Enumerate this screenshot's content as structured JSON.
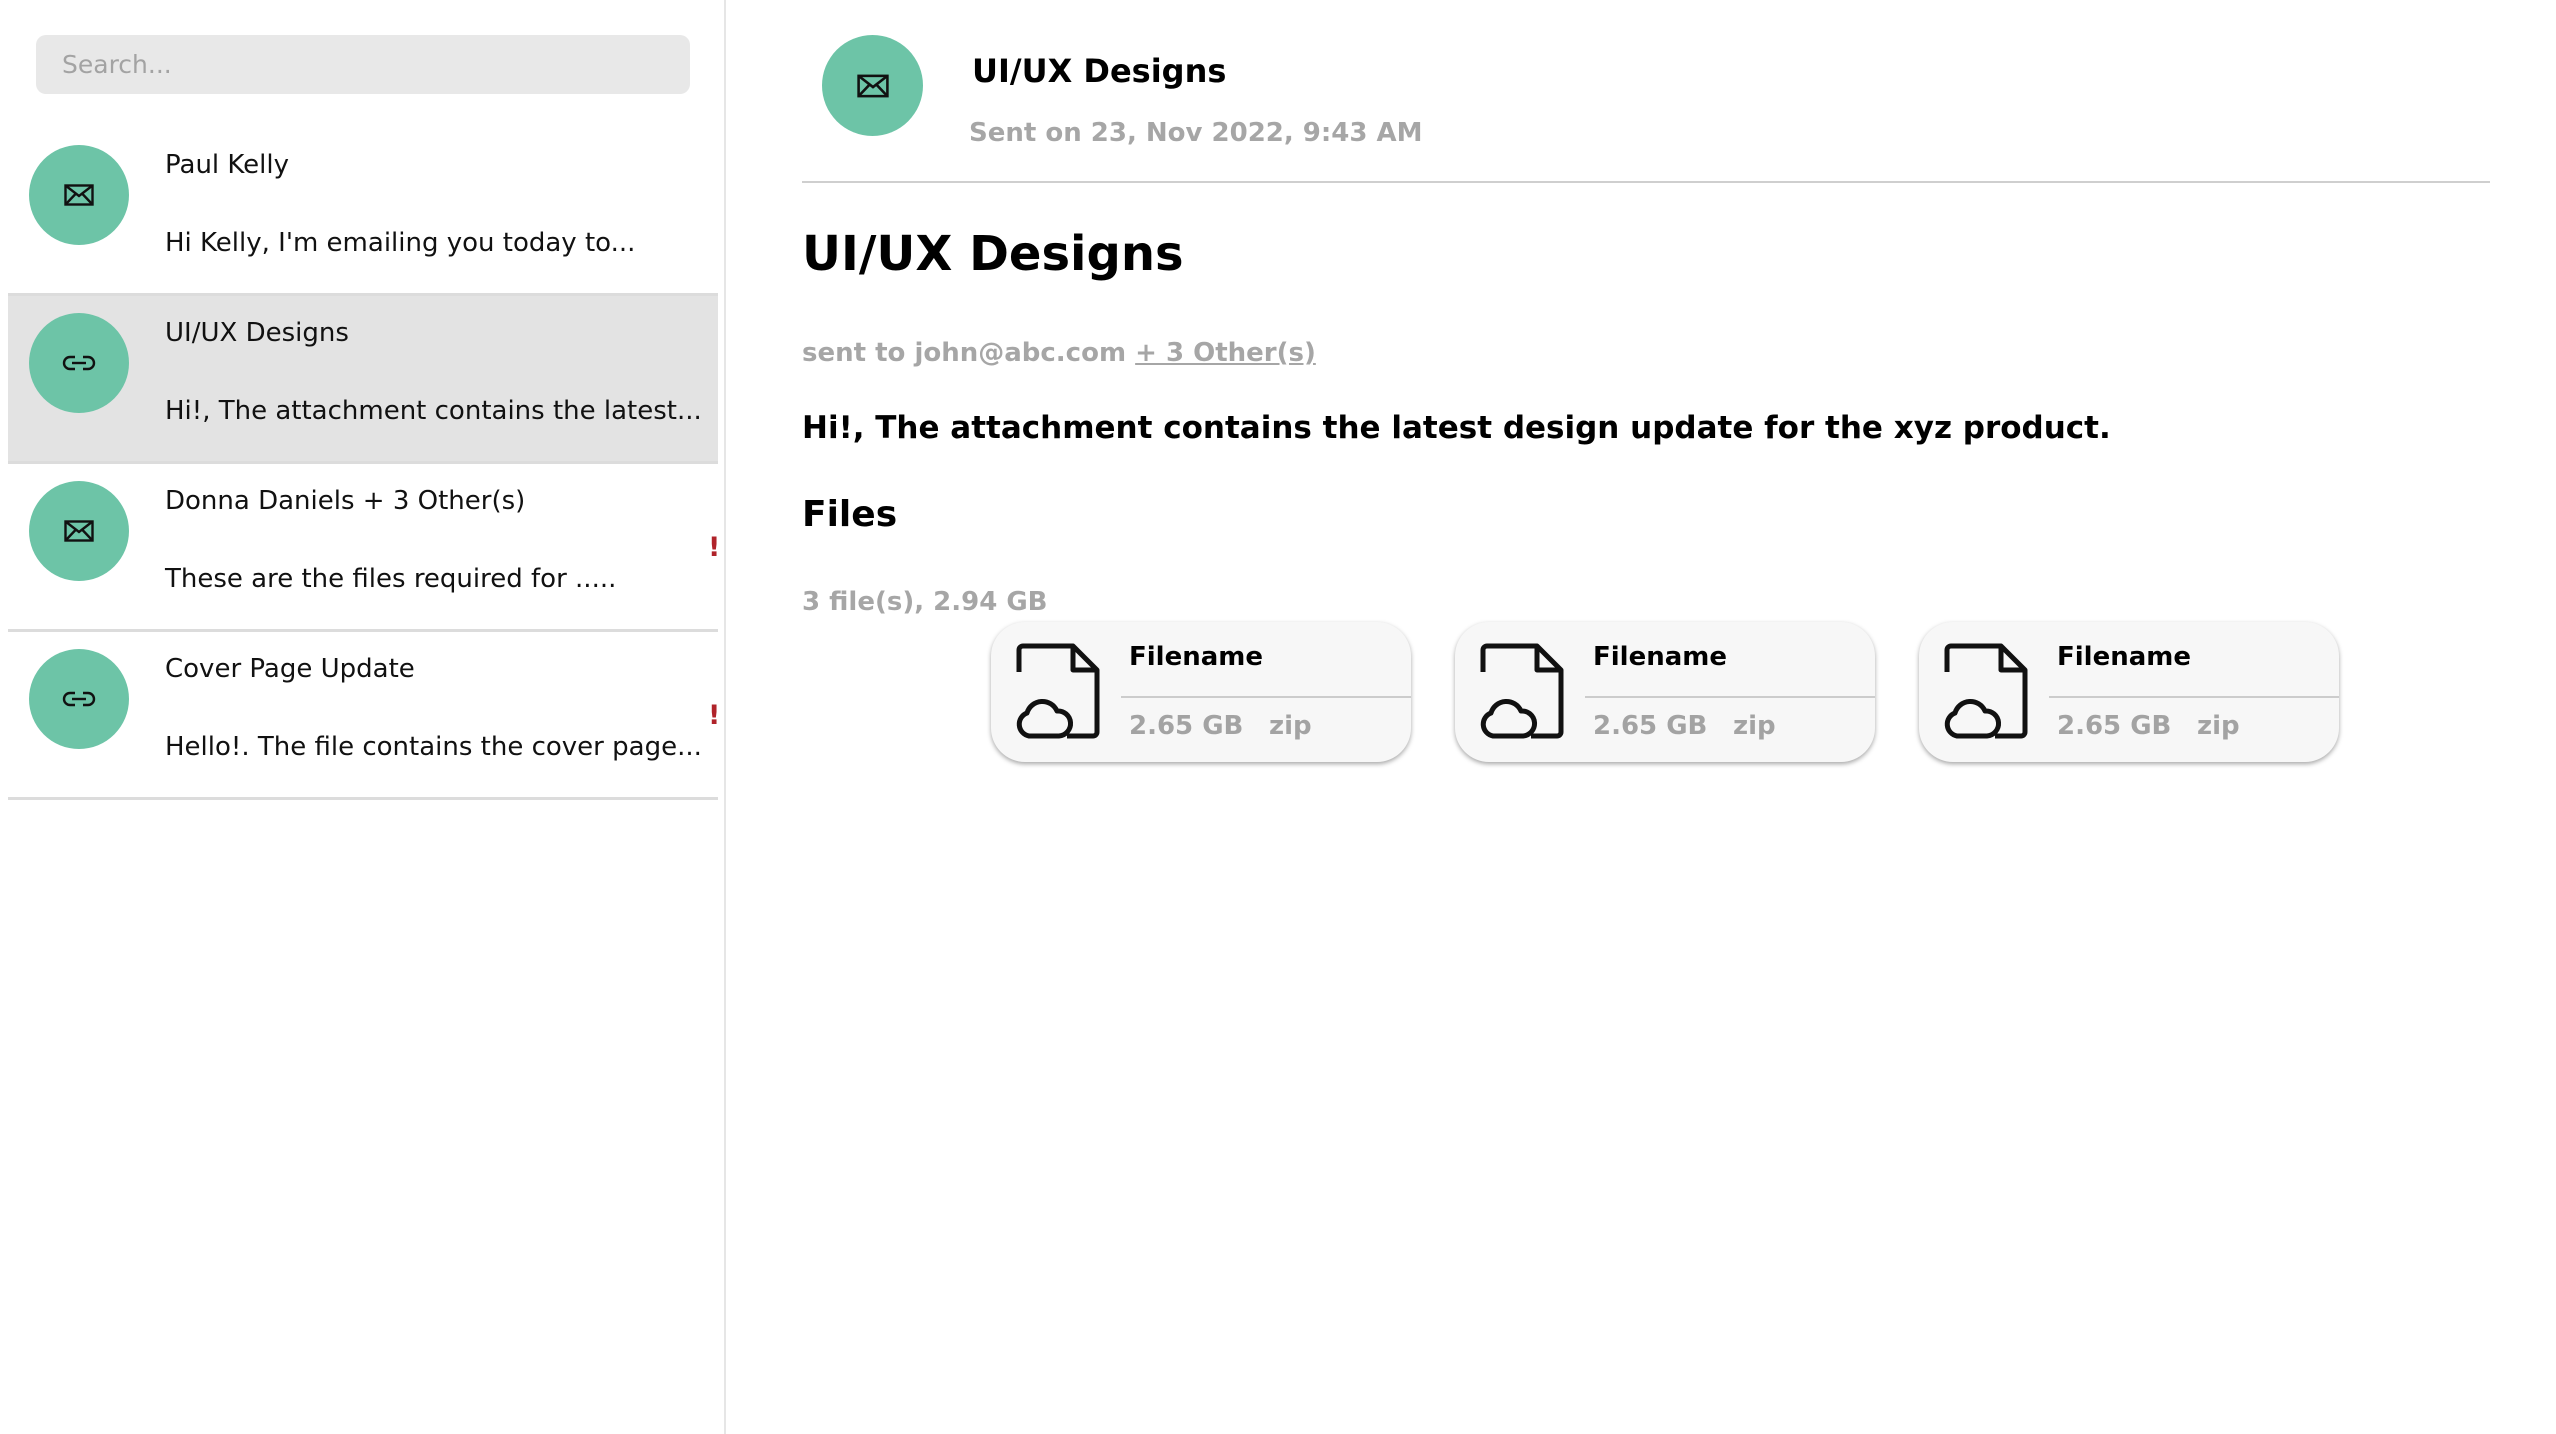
{
  "search": {
    "placeholder": "Search..."
  },
  "mails": [
    {
      "title": "Paul Kelly",
      "preview": "Hi Kelly, I'm emailing you today to...",
      "icon": "envelope-icon",
      "important": false,
      "selected": false
    },
    {
      "title": "UI/UX Designs",
      "preview": "Hi!, The attachment contains the latest...",
      "icon": "link-icon",
      "important": false,
      "selected": true
    },
    {
      "title": "Donna Daniels + 3 Other(s)",
      "preview": "These are the files required for .....",
      "icon": "envelope-icon",
      "important": true,
      "selected": false
    },
    {
      "title": "Cover Page Update",
      "preview": "Hello!. The file contains the cover page...",
      "icon": "link-icon",
      "important": true,
      "selected": false
    }
  ],
  "flag_symbol": "!",
  "detail": {
    "header_subject": "UI/UX Designs",
    "sent_date": "Sent on 23, Nov 2022, 9:43 AM",
    "heading": "UI/UX Designs",
    "sent_to_prefix": "sent to john@abc.com",
    "sent_to_others": "+ 3 Other(s)",
    "body": "Hi!, The attachment contains the latest design update for the xyz product.",
    "files_heading": "Files",
    "files_summary": "3 file(s), 2.94 GB",
    "files": [
      {
        "name": "Filename",
        "size": "2.65 GB",
        "ext": "zip"
      },
      {
        "name": "Filename",
        "size": "2.65 GB",
        "ext": "zip"
      },
      {
        "name": "Filename",
        "size": "2.65 GB",
        "ext": "zip"
      }
    ]
  },
  "colors": {
    "avatar": "#6dc4a7",
    "selected_row": "#e3e3e3",
    "flag": "#b0232a",
    "muted_text": "#a6a6a6"
  }
}
